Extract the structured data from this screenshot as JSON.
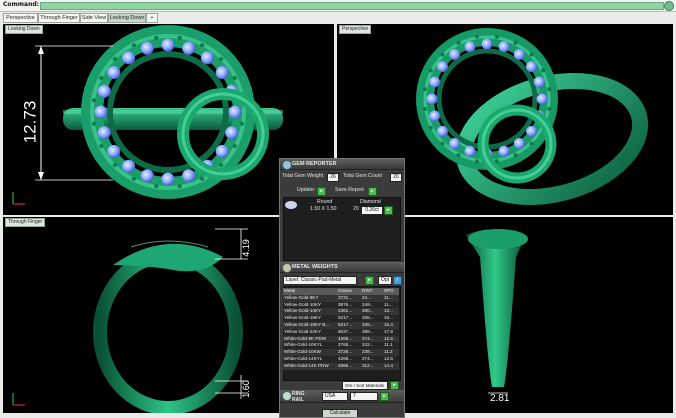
{
  "command": {
    "label": "Command:"
  },
  "tabs": [
    {
      "label": "Perspective"
    },
    {
      "label": "Through Finger"
    },
    {
      "label": "Side View"
    },
    {
      "label": "Looking Down"
    },
    {
      "label": "+"
    }
  ],
  "viewports": {
    "top_left": {
      "label": "Looking Down",
      "dimension": "12.73"
    },
    "top_right": {
      "label": "Perspective"
    },
    "bottom_left": {
      "label": "Through Finger",
      "dim_top": "4.19",
      "dim_bottom": "1.60"
    },
    "bottom_right": {
      "dim_bottom": "2.81"
    }
  },
  "gem_reporter": {
    "title": "GEM REPORTER",
    "total_weight_label": "Total Gem Weight",
    "total_weight_value": "26",
    "total_count_label": "Total Gem Count",
    "total_count_value": "20",
    "update_label": "Update:",
    "save_label": "Save Report",
    "columns": [
      "Round",
      "Diamond"
    ],
    "row": {
      "size": "1.50 X 1.50",
      "count": "20",
      "weight": "0.26ct"
    }
  },
  "metal_weights": {
    "title": "METAL WEIGHTS",
    "dropdown_value": "Lavel: Classic-Pad-Metal",
    "opt_label": "Opt",
    "headers": [
      "Metal",
      "Grams",
      "DWT",
      "SPG"
    ],
    "rows": [
      [
        "Yellow-Gold-9KY",
        "3731...",
        "24...",
        "11..."
      ],
      [
        "Yellow-Gold-10KY",
        "3876...",
        "249...",
        "11..."
      ],
      [
        "Yellow-Gold-14KY",
        "4361...",
        "280...",
        "13..."
      ],
      [
        "Yellow-Gold-18KY",
        "5217...",
        "335...",
        "15..."
      ],
      [
        "Yellow-Gold-18KY B...",
        "5217...",
        "335...",
        "15.4"
      ],
      [
        "Yellow-Gold-22KY",
        "6037...",
        "388...",
        "17.8"
      ],
      [
        "White-Gold-9K PDW",
        "4269...",
        "274...",
        "12.6"
      ],
      [
        "White-Gold-10KYL",
        "3766...",
        "242...",
        "11.1"
      ],
      [
        "White-Gold-10KW",
        "3726...",
        "239...",
        "11.2"
      ],
      [
        "White-Gold-14KYL",
        "4269...",
        "274...",
        "12.6"
      ],
      [
        "White-Gold-14K PDW",
        "4865...",
        "312...",
        "14.4"
      ]
    ],
    "footer_label": "Ore / Sort Materials"
  },
  "ring_rail": {
    "title": "RING RAIL",
    "region": "USA",
    "size": "7",
    "button_label": "Calculate"
  }
}
